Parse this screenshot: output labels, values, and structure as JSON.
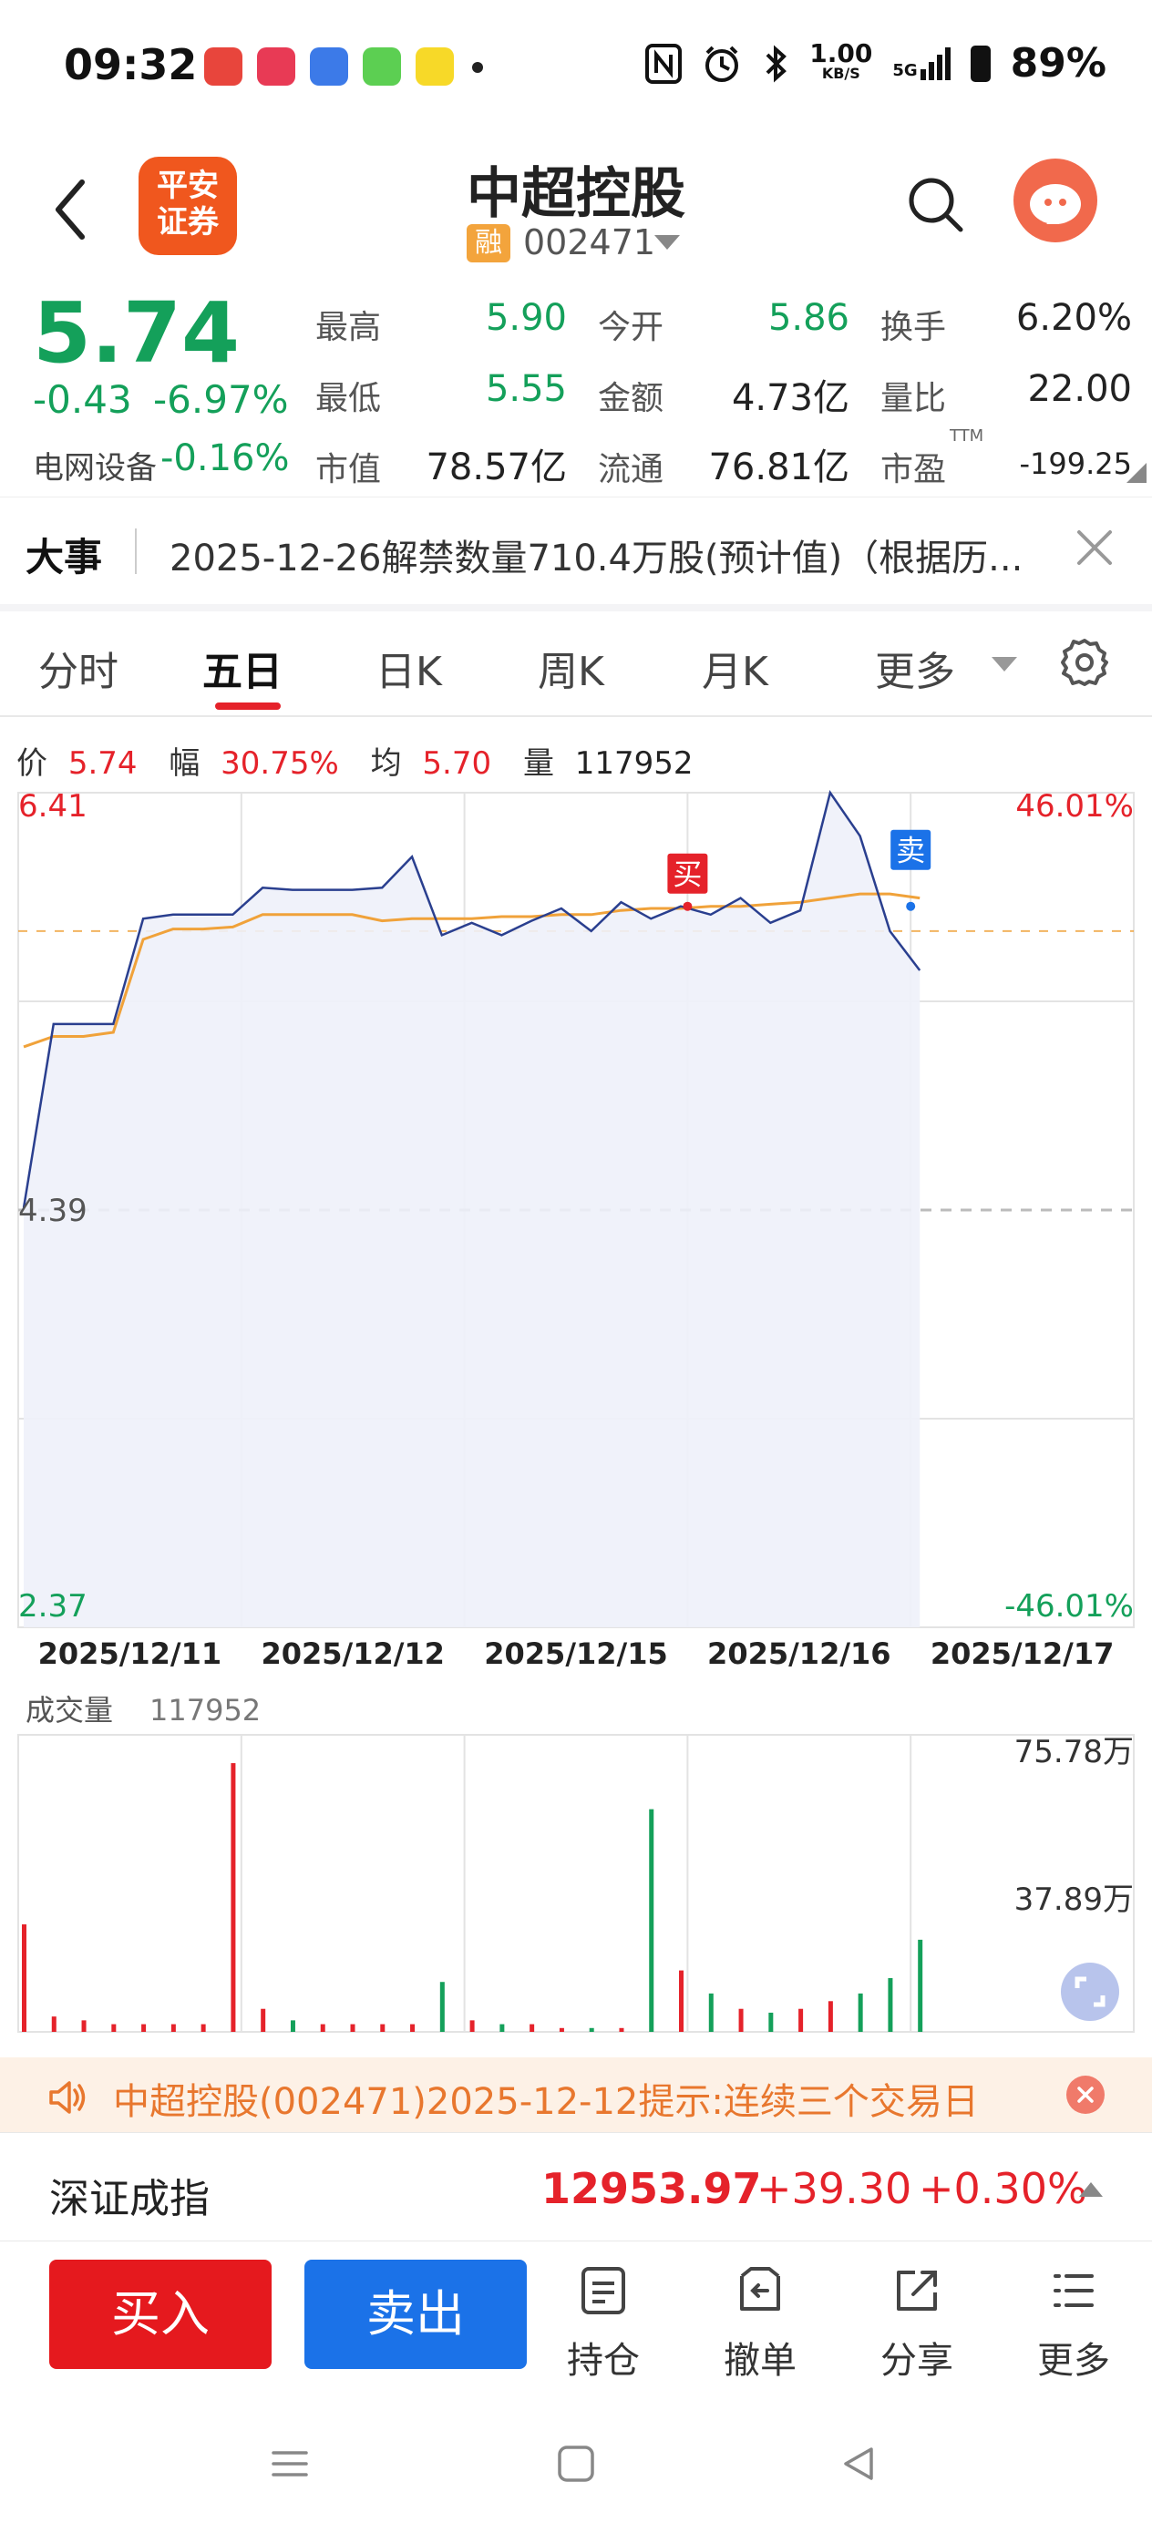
{
  "status_bar": {
    "time": "09:32",
    "net_speed_top": "1.00",
    "net_speed_bottom": "KB/S",
    "signal": "5G",
    "battery": "89%"
  },
  "header": {
    "broker_logo_line1": "平安",
    "broker_logo_line2": "证券",
    "stock_name": "中超控股",
    "margin_badge": "融",
    "stock_code": "002471"
  },
  "quote": {
    "price": "5.74",
    "change": "-0.43",
    "change_pct": "-6.97%",
    "sector_name": "电网设备",
    "sector_pct": "-0.16%",
    "fields": [
      {
        "label": "最高",
        "value": "5.90"
      },
      {
        "label": "今开",
        "value": "5.86"
      },
      {
        "label": "换手",
        "value": "6.20%"
      },
      {
        "label": "最低",
        "value": "5.55"
      },
      {
        "label": "金额",
        "value": "4.73亿"
      },
      {
        "label": "量比",
        "value": "22.00"
      },
      {
        "label": "市值",
        "value": "78.57亿"
      },
      {
        "label": "流通",
        "value": "76.81亿"
      },
      {
        "label": "市盈",
        "value": "-199.25"
      }
    ],
    "pe_suffix": "TTM"
  },
  "events": {
    "title": "大事",
    "text": "2025-12-26解禁数量710.4万股(预计值)（根据历..."
  },
  "tabs": [
    "分时",
    "五日",
    "日K",
    "周K",
    "月K",
    "更多"
  ],
  "info_row": {
    "price_label": "价",
    "price": "5.74",
    "amp_label": "幅",
    "amp": "30.75%",
    "avg_label": "均",
    "avg": "5.70",
    "vol_label": "量",
    "vol": "117952"
  },
  "colors": {
    "up": "#e5222a",
    "down": "#14a05a",
    "price_line": "#2a3f8f",
    "avg_line": "#f0a23a",
    "buy": "#e5191e",
    "sell": "#1b72e8"
  },
  "chart_data": {
    "type": "line",
    "title": "",
    "y_axis_left": {
      "top": "6.41",
      "mid": "4.39",
      "bottom": "2.37"
    },
    "y_axis_right": {
      "top": "46.01%",
      "bottom": "-46.01%"
    },
    "ylim": [
      2.37,
      6.41
    ],
    "x": [
      "2025/12/11",
      "2025/12/12",
      "2025/12/15",
      "2025/12/16",
      "2025/12/17"
    ],
    "series": [
      {
        "values": [
          4.4,
          5.29,
          5.29,
          5.29,
          5.8,
          5.82,
          5.82,
          5.82,
          5.95,
          5.94,
          5.94,
          5.94,
          5.95,
          6.1,
          5.72,
          5.78,
          5.72,
          5.79,
          5.85,
          5.74,
          5.88,
          5.8,
          5.86,
          5.82,
          5.9,
          5.78,
          5.84,
          6.41,
          6.2,
          5.74,
          5.55
        ]
      },
      {
        "values": [
          5.18,
          5.23,
          5.23,
          5.25,
          5.7,
          5.75,
          5.75,
          5.76,
          5.82,
          5.82,
          5.82,
          5.82,
          5.79,
          5.8,
          5.8,
          5.8,
          5.81,
          5.81,
          5.82,
          5.82,
          5.84,
          5.85,
          5.85,
          5.86,
          5.86,
          5.87,
          5.88,
          5.9,
          5.92,
          5.92,
          5.9
        ]
      }
    ],
    "markers": {
      "buy": "买",
      "sell": "卖"
    },
    "volume": {
      "title": "成交量",
      "total": "117952",
      "y_top": "75.78万",
      "y_mid": "37.89万",
      "bars": [
        28,
        4,
        3,
        2,
        2,
        2,
        2,
        70,
        6,
        3,
        2,
        2,
        2,
        2,
        13,
        3,
        2,
        2,
        1,
        1,
        1,
        58,
        16,
        10,
        6,
        5,
        6,
        8,
        10,
        14,
        24
      ]
    }
  },
  "notice": {
    "text": "中超控股(002471)2025-12-12提示:连续三个交易日"
  },
  "index": {
    "name": "深证成指",
    "value": "12953.97",
    "change": "+39.30",
    "pct": "+0.30%"
  },
  "actions": {
    "buy": "买入",
    "sell": "卖出",
    "items": [
      "持仓",
      "撤单",
      "分享",
      "更多"
    ]
  }
}
